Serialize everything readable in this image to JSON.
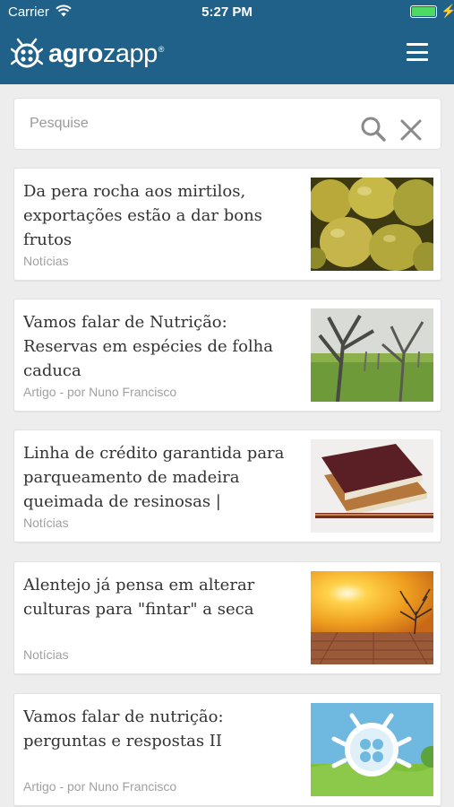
{
  "status_bar": {
    "carrier": "Carrier",
    "time": "5:27 PM"
  },
  "header": {
    "brand_bold": "agro",
    "brand_light": "zapp",
    "brand_reg": "®"
  },
  "search": {
    "placeholder": "Pesquise",
    "value": ""
  },
  "articles": [
    {
      "title": "Da pera rocha aos mirtilos, exportações estão a dar bons frutos",
      "meta": "Notícias",
      "image": "pears"
    },
    {
      "title": "Vamos falar de Nutrição: Reservas em espécies de folha caduca",
      "meta": "Artigo - por Nuno Francisco",
      "image": "orchard"
    },
    {
      "title": "Linha de crédito garantida para parqueamento de madeira queimada de resinosas | Decreto...",
      "meta": "Notícias",
      "image": "books"
    },
    {
      "title": "Alentejo já pensa em alterar culturas para \"fintar\" a seca",
      "meta": "Notícias",
      "image": "drought"
    },
    {
      "title": "Vamos falar de nutrição: perguntas e respostas II",
      "meta": "Artigo - por Nuno Francisco",
      "image": "agrozapp-logo"
    }
  ],
  "colors": {
    "header": "#1f6189",
    "background": "#ededed",
    "meta_text": "#a0a0a0"
  }
}
